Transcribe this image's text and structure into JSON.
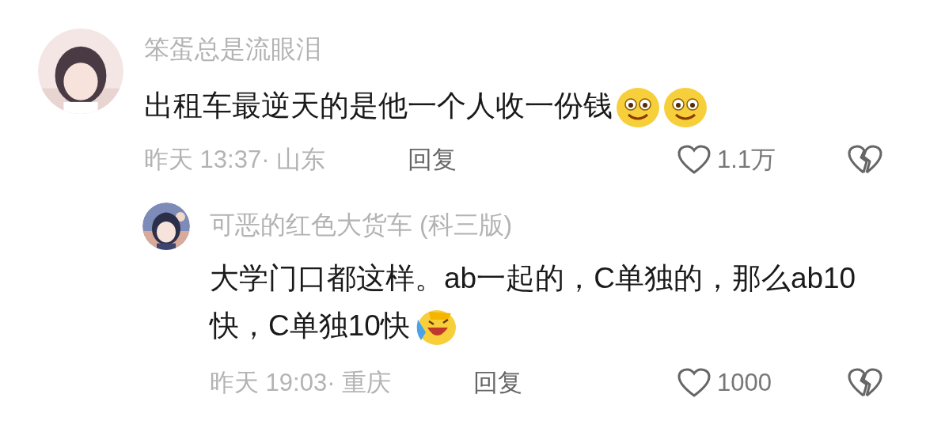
{
  "comments": [
    {
      "username": "笨蛋总是流眼泪",
      "text": "出租车最逆天的是他一个人收一份钱",
      "emojis": [
        {
          "kind": "smile"
        },
        {
          "kind": "smile"
        }
      ],
      "time": "昨天 13:37· 山东",
      "reply_label": "回复",
      "likes": "1.1万",
      "reply": {
        "username": "可恶的红色大货车 (科三版)",
        "text": "大学门口都这样。ab一起的，C单独的，那么ab10快，C单独10快",
        "emojis": [
          {
            "kind": "laugh-cry"
          }
        ],
        "time": "昨天 19:03· 重庆",
        "reply_label": "回复",
        "likes": "1000"
      }
    }
  ]
}
